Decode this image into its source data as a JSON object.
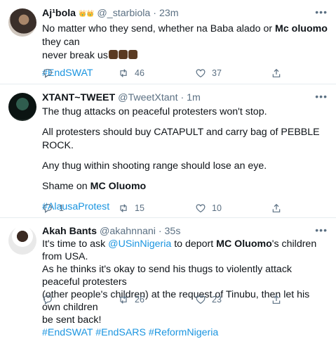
{
  "tweets": [
    {
      "name": "Aj¹bola",
      "name_emoji": "👑👑",
      "handle": "@_starbiola",
      "time": "23m",
      "lines": [
        {
          "parts": [
            "No matter who they send, whether na Baba alado or ",
            "Mc oluomo",
            " they can"
          ]
        },
        {
          "parts": [
            "never break us"
          ]
        },
        {
          "parts": [
            "#EndSWAT"
          ]
        }
      ],
      "counts": {
        "reply": "",
        "retweet": "46",
        "like": "37"
      }
    },
    {
      "name": "XTANT~TWEET",
      "handle": "@TweetXtant",
      "time": "1m",
      "lines": [
        {
          "parts": [
            "The thug attacks on peaceful protesters won't stop."
          ]
        },
        {
          "parts": [
            "All protesters  should buy CATAPULT and carry bag of PEBBLE ROCK."
          ]
        },
        {
          "parts": [
            "Any thug within shooting range should lose an eye."
          ]
        },
        {
          "parts": [
            "Shame on ",
            "MC Oluomo"
          ]
        },
        {
          "parts": [
            "#AlausaProtest"
          ]
        }
      ],
      "counts": {
        "reply": "1",
        "retweet": "15",
        "like": "10"
      }
    },
    {
      "name": "Akah Bants",
      "handle": "@akahnnani",
      "time": "35s",
      "lines": [
        {
          "parts": [
            "It's time to ask ",
            "@USinNigeria",
            " to deport ",
            "MC Oluomo",
            "'s children from USA."
          ]
        },
        {
          "parts": [
            "As he thinks it's okay to send his thugs to violently attack peaceful protesters"
          ]
        },
        {
          "parts": [
            "(other people's children) at the request of Tinubu, then let his own children"
          ]
        },
        {
          "parts": [
            "be sent back!"
          ]
        },
        {
          "parts": [
            "#EndSWAT #EndSARS #ReformNigeria"
          ]
        }
      ],
      "counts": {
        "reply": "",
        "retweet": "26",
        "like": "23"
      }
    }
  ],
  "icons": {
    "reply": "reply-icon",
    "retweet": "retweet-icon",
    "like": "heart-icon",
    "share": "share-icon",
    "more": "more-icon"
  },
  "colors": {
    "link": "#1b95e0",
    "muted": "#5b7083",
    "divider": "#e6ecf0"
  }
}
